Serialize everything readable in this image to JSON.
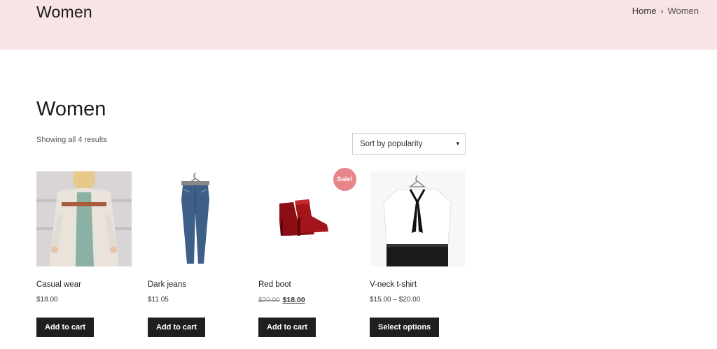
{
  "header": {
    "title": "Women",
    "breadcrumb": {
      "home": "Home",
      "separator": "›",
      "current": "Women"
    }
  },
  "main": {
    "title": "Women",
    "result_count": "Showing all 4 results",
    "sort": {
      "selected": "Sort by popularity",
      "caret": "▾"
    }
  },
  "products": [
    {
      "name": "Casual wear",
      "price": "$18.00",
      "button": "Add to cart"
    },
    {
      "name": "Dark jeans",
      "price": "$11.05",
      "button": "Add to cart"
    },
    {
      "name": "Red boot",
      "old_price": "$20.00",
      "sale_price": "$18.00",
      "badge": "Sale!",
      "button": "Add to cart"
    },
    {
      "name": "V-neck t-shirt",
      "price": "$15.00 – $20.00",
      "button": "Select options"
    }
  ],
  "colors": {
    "header_band": "#f8e3e6",
    "button": "#1f1f1f",
    "sale_badge": "#e8858b"
  }
}
